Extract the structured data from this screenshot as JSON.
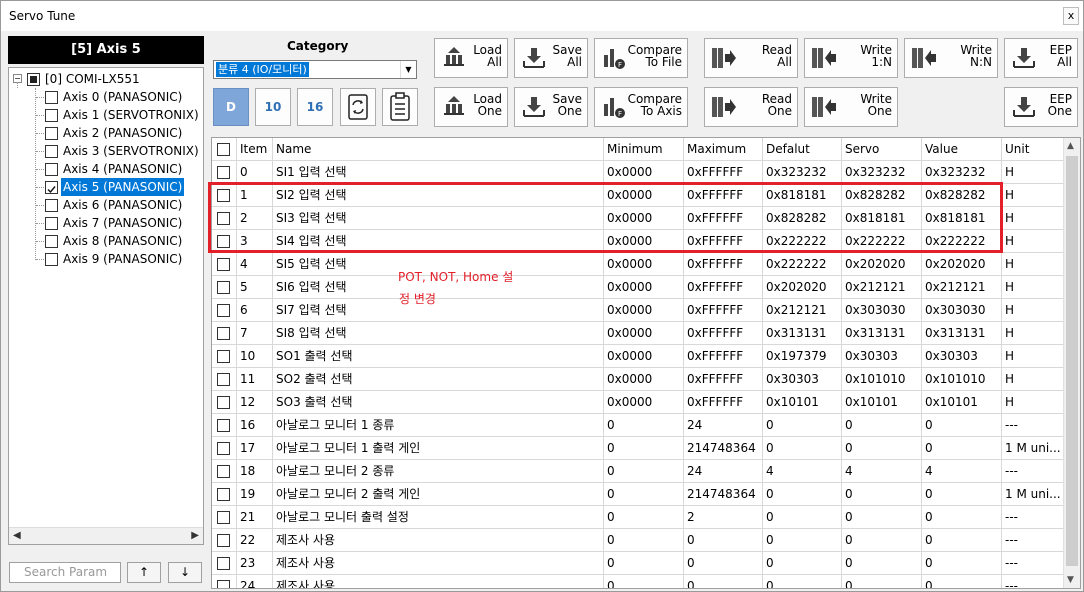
{
  "window": {
    "title": "Servo Tune",
    "close_glyph": "x"
  },
  "left_panel": {
    "axis_header": "[5]  Axis  5",
    "root": "[0]  COMI-LX551",
    "axes": [
      {
        "label": "Axis  0 (PANASONIC)",
        "checked": false,
        "selected": false
      },
      {
        "label": "Axis  1 (SERVOTRONIX)",
        "checked": false,
        "selected": false
      },
      {
        "label": "Axis  2 (PANASONIC)",
        "checked": false,
        "selected": false
      },
      {
        "label": "Axis  3 (SERVOTRONIX)",
        "checked": false,
        "selected": false
      },
      {
        "label": "Axis  4 (PANASONIC)",
        "checked": false,
        "selected": false
      },
      {
        "label": "Axis  5 (PANASONIC)",
        "checked": true,
        "selected": true
      },
      {
        "label": "Axis  6 (PANASONIC)",
        "checked": false,
        "selected": false
      },
      {
        "label": "Axis  7 (PANASONIC)",
        "checked": false,
        "selected": false
      },
      {
        "label": "Axis  8 (PANASONIC)",
        "checked": false,
        "selected": false
      },
      {
        "label": "Axis  9 (PANASONIC)",
        "checked": false,
        "selected": false
      }
    ],
    "search_placeholder": "Search Param",
    "up_glyph": "↑",
    "down_glyph": "↓"
  },
  "toolbar": {
    "category_label": "Category",
    "category_value": "분류 4 (IO/모니터)",
    "buttons": {
      "load_all": "Load\nAll",
      "save_all": "Save\nAll",
      "compare_file": "Compare\nTo File",
      "read_all": "Read\nAll",
      "write_1n": "Write\n1:N",
      "write_nn": "Write\nN:N",
      "eep_all": "EEP\nAll",
      "load_one": "Load\nOne",
      "save_one": "Save\nOne",
      "compare_axis": "Compare\nTo Axis",
      "read_one": "Read\nOne",
      "write_one": "Write\nOne",
      "eep_one": "EEP\nOne"
    },
    "radix": {
      "dec": "D",
      "ten": "10",
      "hex": "16"
    }
  },
  "grid": {
    "columns": [
      "Item",
      "Name",
      "Minimum",
      "Maximum",
      "Defalut",
      "Servo",
      "Value",
      "Unit"
    ],
    "rows": [
      [
        "0",
        "SI1 입력 선택",
        "0x0000",
        "0xFFFFFF",
        "0x323232",
        "0x323232",
        "0x323232",
        "H"
      ],
      [
        "1",
        "SI2 입력 선택",
        "0x0000",
        "0xFFFFFF",
        "0x818181",
        "0x828282",
        "0x828282",
        "H"
      ],
      [
        "2",
        "SI3 입력 선택",
        "0x0000",
        "0xFFFFFF",
        "0x828282",
        "0x818181",
        "0x818181",
        "H"
      ],
      [
        "3",
        "SI4 입력 선택",
        "0x0000",
        "0xFFFFFF",
        "0x222222",
        "0x222222",
        "0x222222",
        "H"
      ],
      [
        "4",
        "SI5 입력 선택",
        "0x0000",
        "0xFFFFFF",
        "0x222222",
        "0x202020",
        "0x202020",
        "H"
      ],
      [
        "5",
        "SI6 입력 선택",
        "0x0000",
        "0xFFFFFF",
        "0x202020",
        "0x212121",
        "0x212121",
        "H"
      ],
      [
        "6",
        "SI7 입력 선택",
        "0x0000",
        "0xFFFFFF",
        "0x212121",
        "0x303030",
        "0x303030",
        "H"
      ],
      [
        "7",
        "SI8 입력 선택",
        "0x0000",
        "0xFFFFFF",
        "0x313131",
        "0x313131",
        "0x313131",
        "H"
      ],
      [
        "10",
        "SO1 출력 선택",
        "0x0000",
        "0xFFFFFF",
        "0x197379",
        "0x30303",
        "0x30303",
        "H"
      ],
      [
        "11",
        "SO2 출력 선택",
        "0x0000",
        "0xFFFFFF",
        "0x30303",
        "0x101010",
        "0x101010",
        "H"
      ],
      [
        "12",
        "SO3 출력 선택",
        "0x0000",
        "0xFFFFFF",
        "0x10101",
        "0x10101",
        "0x10101",
        "H"
      ],
      [
        "16",
        "아날로그 모니터 1 종류",
        "0",
        "24",
        "0",
        "0",
        "0",
        "---"
      ],
      [
        "17",
        "아날로그 모니터 1 출력 게인",
        "0",
        "214748364",
        "0",
        "0",
        "0",
        "1 M uni..."
      ],
      [
        "18",
        "아날로그 모니터 2 종류",
        "0",
        "24",
        "4",
        "4",
        "4",
        "---"
      ],
      [
        "19",
        "아날로그 모니터 2 출력 게인",
        "0",
        "214748364",
        "0",
        "0",
        "0",
        "1 M uni..."
      ],
      [
        "21",
        "아날로그 모니터 출력 설정",
        "0",
        "2",
        "0",
        "0",
        "0",
        "---"
      ],
      [
        "22",
        "제조사 사용",
        "0",
        "0",
        "0",
        "0",
        "0",
        "---"
      ],
      [
        "23",
        "제조사 사용",
        "0",
        "0",
        "0",
        "0",
        "0",
        "---"
      ],
      [
        "24",
        "제조사 사용",
        "0",
        "0",
        "0",
        "0",
        "0",
        "---"
      ]
    ]
  },
  "annotation": {
    "line1": "POT, NOT, Home 설",
    "line2": "정 변경",
    "color": "#e3202a"
  }
}
